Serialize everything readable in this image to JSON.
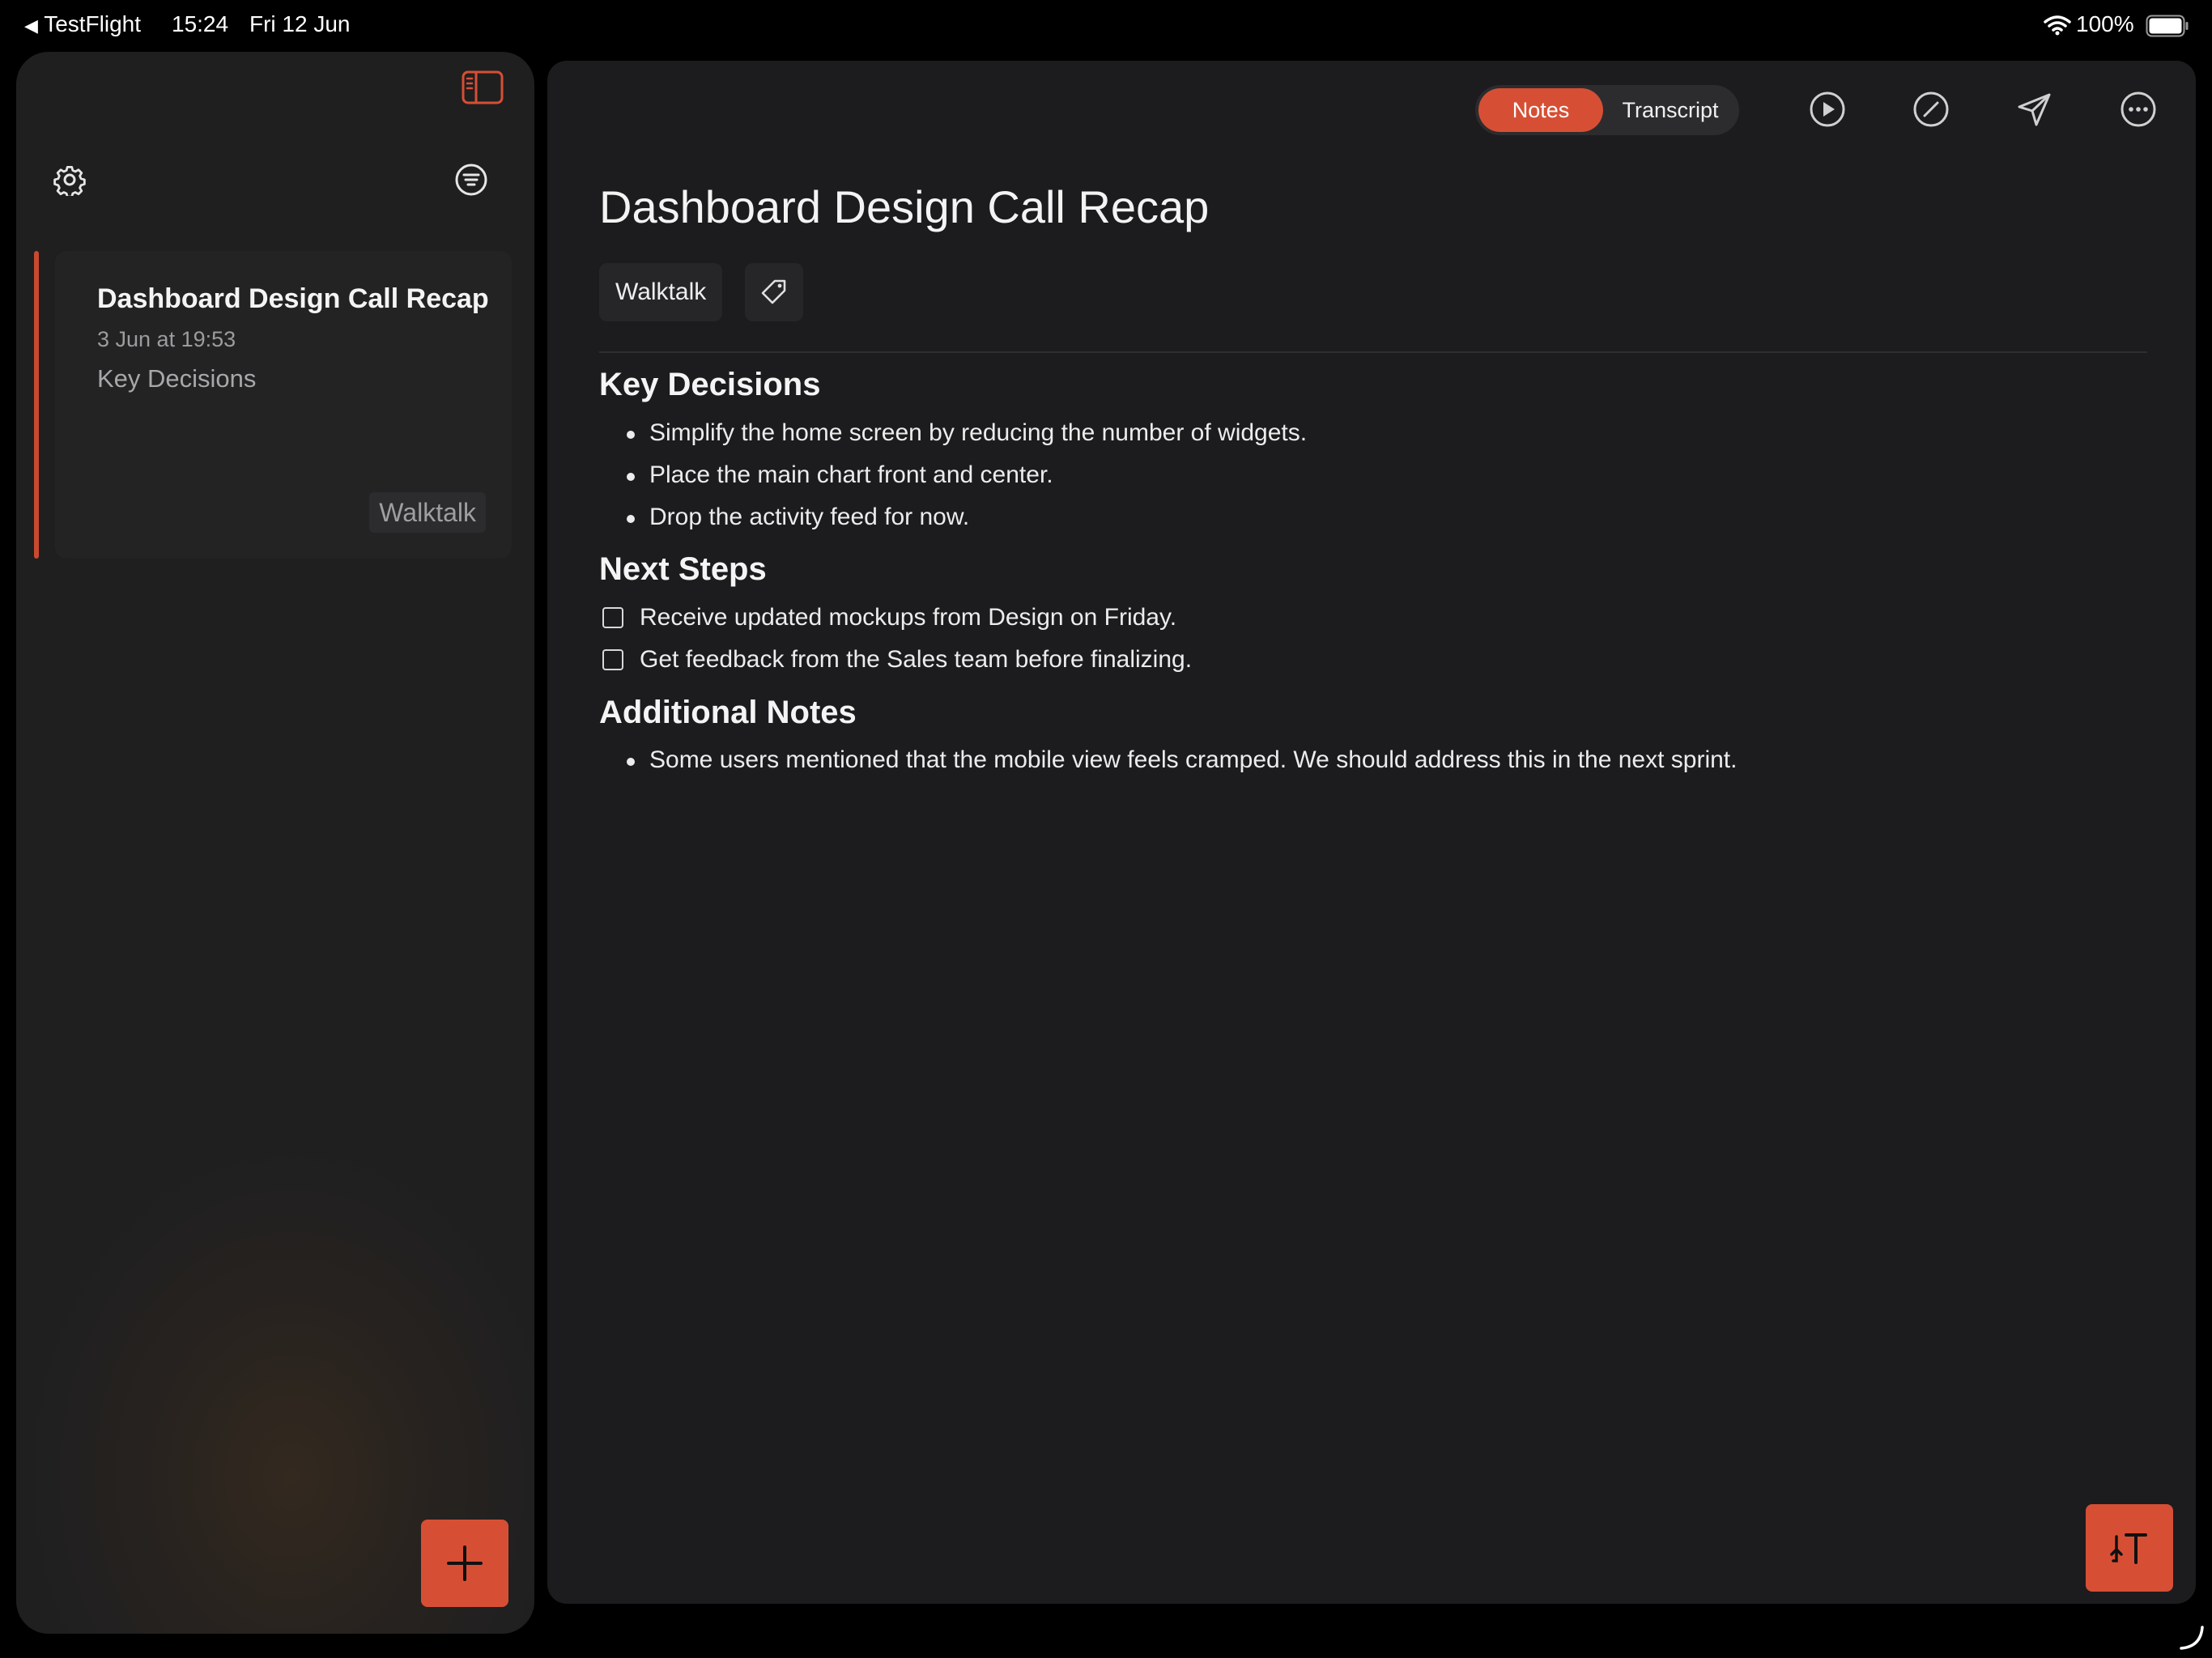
{
  "status_bar": {
    "back_app": "TestFlight",
    "time": "15:24",
    "date": "Fri 12 Jun",
    "battery": "100%"
  },
  "sidebar": {
    "note": {
      "title": "Dashboard Design Call Recap",
      "date": "3 Jun at 19:53",
      "preview": "Key Decisions",
      "tag": "Walktalk"
    }
  },
  "toolbar": {
    "segments": [
      "Notes",
      "Transcript"
    ],
    "selected_segment": "Notes"
  },
  "document": {
    "title": "Dashboard Design Call Recap",
    "tag": "Walktalk",
    "sections": [
      {
        "heading": "Key Decisions",
        "bullets": [
          "Simplify the home screen by reducing the number of widgets.",
          "Place the main chart front and center.",
          "Drop the activity feed for now."
        ]
      },
      {
        "heading": "Next Steps",
        "todos": [
          "Receive updated mockups from Design on Friday.",
          "Get feedback from the Sales team before finalizing."
        ]
      },
      {
        "heading": "Additional Notes",
        "bullets": [
          "Some users mentioned that the mobile view feels cramped. We should address this in the next sprint."
        ]
      }
    ]
  },
  "colors": {
    "accent": "#d64f35",
    "background": "#1c1c1e",
    "sidebar": "#1f1f20"
  },
  "icons": [
    "sidebar-toggle-icon",
    "settings-gear-icon",
    "filter-icon",
    "plus-icon",
    "play-icon",
    "edit-icon",
    "send-icon",
    "more-icon",
    "tag-icon",
    "translate-icon",
    "wifi-icon",
    "battery-icon"
  ]
}
